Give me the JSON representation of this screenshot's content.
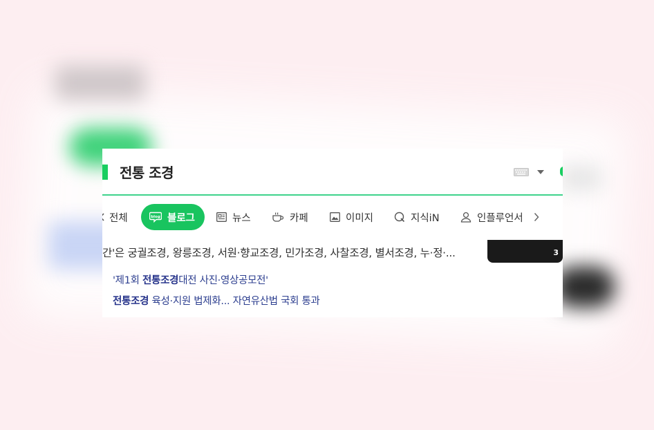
{
  "search": {
    "query": "전통 조경"
  },
  "tabs": [
    {
      "label": "전체",
      "icon": "back-chevron-icon",
      "active": false
    },
    {
      "label": "블로그",
      "icon": "blog-icon",
      "active": true
    },
    {
      "label": "뉴스",
      "icon": "news-icon",
      "active": false
    },
    {
      "label": "카페",
      "icon": "cafe-icon",
      "active": false
    },
    {
      "label": "이미지",
      "icon": "image-icon",
      "active": false
    },
    {
      "label": "지식iN",
      "icon": "kin-icon",
      "active": false
    },
    {
      "label": "인플루언서",
      "icon": "person-icon",
      "active": false
    }
  ],
  "result": {
    "snippet": "간'은 궁궐조경, 왕릉조경, 서원·향교조경, 민가조경, 사찰조경, 별서조경, 누·정·...",
    "thumbnail_count": "3",
    "related_news": [
      {
        "pre": "'제1회 ",
        "bold": "전통조경",
        "post": "대전 사진·영상공모전'"
      },
      {
        "pre": "",
        "bold": "전통조경",
        "post": " 육성·지원 법제화... 자연유산법 국회 통과"
      }
    ]
  },
  "colors": {
    "accent_green": "#19c45f",
    "underline_green": "#3ed38b",
    "link_blue": "#2c3e8f",
    "background_pink": "#fdeef1"
  }
}
